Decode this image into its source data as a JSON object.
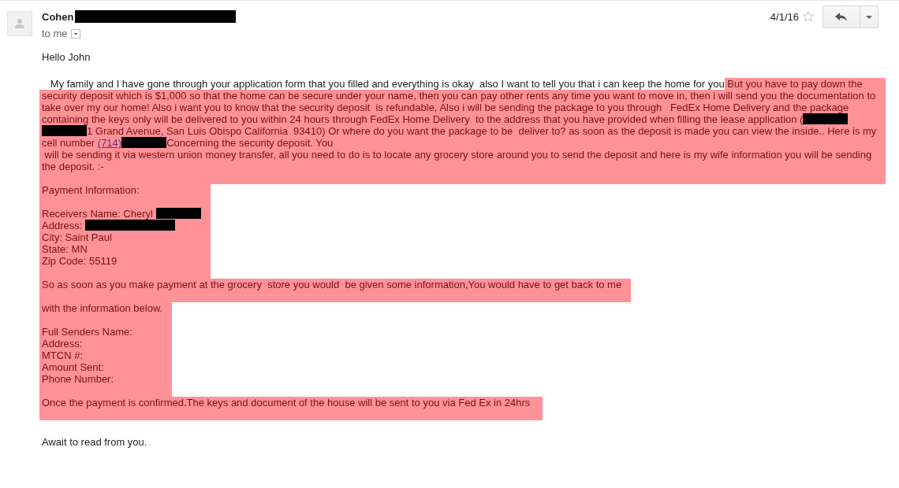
{
  "sender": {
    "name": "Cohen"
  },
  "recipient": "to me",
  "date": "4/1/16",
  "starred": false,
  "greeting": "Hello John",
  "blocks": [
    {
      "highlighted": true,
      "paragraphs": [
        [
          [
            {
              "kind": "text",
              "text": "   My family and I have gone through your application form that you filled and everything is okay  also I want to tell you that i can keep the home for you",
              "highlighted": false
            },
            {
              "kind": "text",
              "text": " But you have to pay down the",
              "highlighted": true
            }
          ],
          [
            {
              "kind": "text",
              "text": "security deposit which is $1,000 so that the home can be secure under your name, then you can pay other rents any time you want to move in, then i will send you the documentation to"
            }
          ],
          [
            {
              "kind": "text",
              "text": "take over my our home! Also i want you to know that the security deposit  is refundable, Also i will be sending the package to you through   FedEx Home Delivery and the package"
            }
          ],
          [
            {
              "kind": "text",
              "text": "containing the keys only will be delivered to you within 24 hours through FedEx Home Delivery  to the address that you have provided when filling the lease application ("
            },
            {
              "kind": "redaction"
            }
          ],
          [
            {
              "kind": "redaction"
            },
            {
              "kind": "text",
              "text": "1 Grand Avenue, San Luis Obispo California  93410) Or where do you want the package to be  deliver to? as soon as the deposit is made you can view the inside.. Here is my"
            }
          ],
          [
            {
              "kind": "text",
              "text": "cell number "
            },
            {
              "kind": "link",
              "text": "(714)"
            },
            {
              "kind": "redaction"
            },
            {
              "kind": "text",
              "text": "Concerning the security deposit. You"
            }
          ],
          [
            {
              "kind": "text",
              "text": " will be sending it via western union money transfer, all you need to do is to locate any grocery store around you to send the deposit and here is my wife information you will be sending"
            }
          ],
          [
            {
              "kind": "text",
              "text": "the deposit. :-"
            }
          ]
        ]
      ]
    },
    {
      "highlighted": true,
      "paragraphs": [
        [
          [
            {
              "kind": "text",
              "text": "Payment Information:"
            }
          ]
        ],
        [
          [
            {
              "kind": "text",
              "text": "Receivers Name: Cheryl "
            },
            {
              "kind": "redaction"
            }
          ],
          [
            {
              "kind": "text",
              "text": "Address: "
            },
            {
              "kind": "redaction"
            },
            {
              "kind": "redaction"
            }
          ],
          [
            {
              "kind": "text",
              "text": "City: Saint Paul"
            }
          ],
          [
            {
              "kind": "text",
              "text": "State: MN"
            }
          ],
          [
            {
              "kind": "text",
              "text": "Zip Code: 55119"
            }
          ]
        ]
      ]
    },
    {
      "highlighted": true,
      "paragraphs": [
        [
          [
            {
              "kind": "text",
              "text": "So as soon as you make payment at the grocery  store you would  be given some information,You would have to get back to me"
            }
          ]
        ]
      ]
    },
    {
      "highlighted": true,
      "paragraphs": [
        [
          [
            {
              "kind": "text",
              "text": "with the information below."
            }
          ]
        ],
        [
          [
            {
              "kind": "text",
              "text": "Full Senders Name:"
            }
          ],
          [
            {
              "kind": "text",
              "text": "Address:"
            }
          ],
          [
            {
              "kind": "text",
              "text": "MTCN #:"
            }
          ],
          [
            {
              "kind": "text",
              "text": "Amount Sent:"
            }
          ],
          [
            {
              "kind": "text",
              "text": "Phone Number:"
            }
          ]
        ]
      ]
    },
    {
      "highlighted": true,
      "paragraphs": [
        [
          [
            {
              "kind": "text",
              "text": "Once the payment is confirmed.The keys and document of the house will be sent to you via Fed Ex in 24hrs "
            }
          ]
        ]
      ]
    },
    {
      "highlighted": false,
      "paragraphs": [
        [
          [
            {
              "kind": "text",
              "text": "Await to read from you."
            }
          ]
        ]
      ]
    }
  ]
}
